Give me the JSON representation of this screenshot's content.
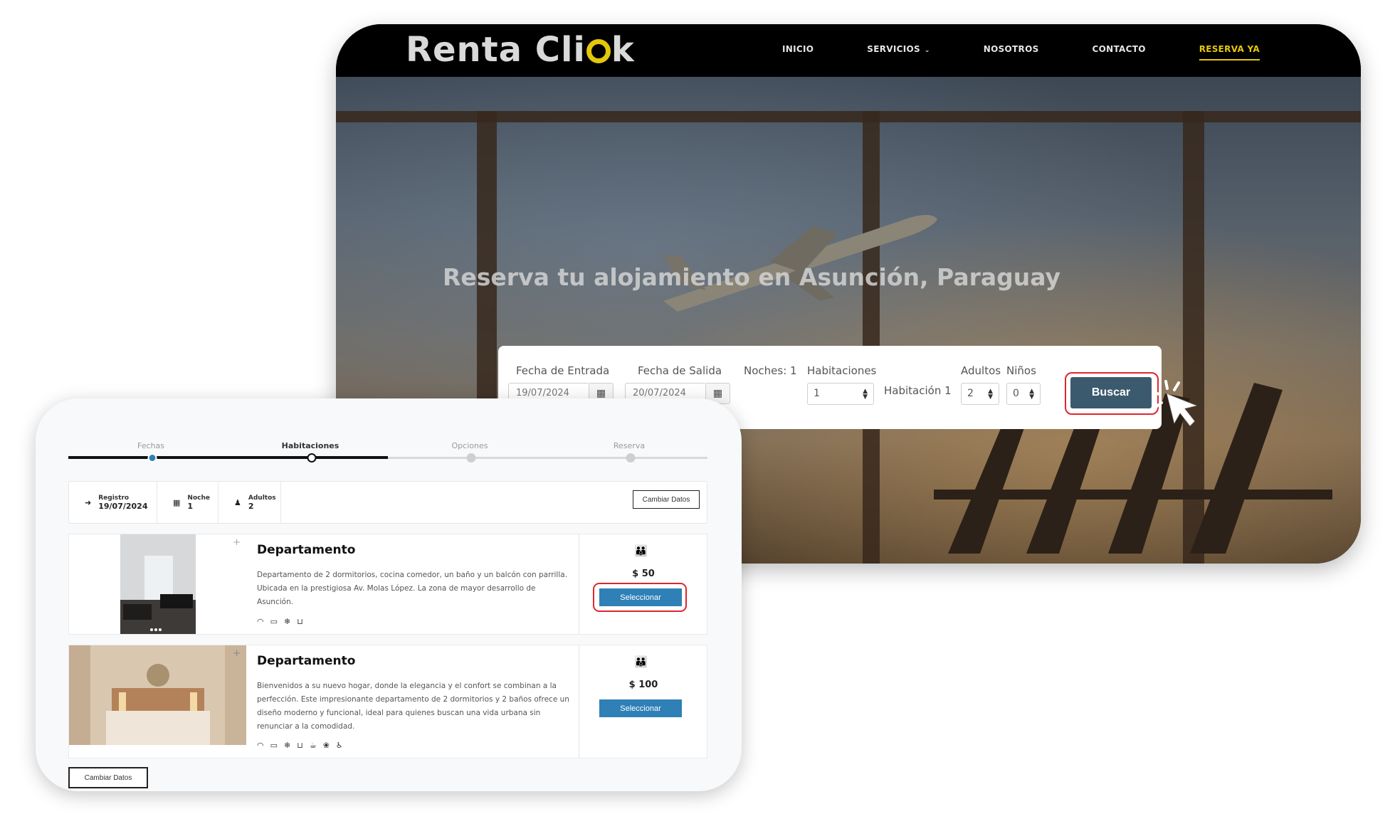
{
  "site": {
    "logo_text_a": "Renta Cli",
    "logo_text_b": "k",
    "nav": [
      {
        "label": "INICIO"
      },
      {
        "label": "SERVICIOS"
      },
      {
        "label": "NOSOTROS"
      },
      {
        "label": "CONTACTO"
      },
      {
        "label": "RESERVA YA"
      }
    ],
    "hero_title": "Reserva tu alojamiento en Asunción, Paraguay",
    "search": {
      "check_in_label": "Fecha de Entrada",
      "check_in_value": "19/07/2024",
      "check_out_label": "Fecha de Salida",
      "check_out_value": "20/07/2024",
      "nights_label": "Noches: 1",
      "rooms_label": "Habitaciones",
      "rooms_value": "1",
      "room_name": "Habitación 1",
      "adults_label": "Adultos",
      "adults_value": "2",
      "children_label": "Niños",
      "children_value": "0",
      "search_button": "Buscar"
    },
    "colors": {
      "accent": "#e3c70b",
      "button": "#3c5a6e",
      "highlight": "#e0262d"
    }
  },
  "booking": {
    "steps": [
      {
        "label": "Fechas"
      },
      {
        "label": "Habitaciones"
      },
      {
        "label": "Opciones"
      },
      {
        "label": "Reserva"
      }
    ],
    "summary": {
      "checkin_label": "Registro",
      "checkin_value": "19/07/2024",
      "night_label": "Noche",
      "night_value": "1",
      "adults_label": "Adultos",
      "adults_value": "2",
      "change_button": "Cambiar Datos"
    },
    "rooms": [
      {
        "name": "Departamento",
        "description": "Departamento de 2 dormitorios, cocina comedor, un baño y un balcón con parrilla. Ubicada en la prestigiosa Av. Molas López. La zona de mayor desarrollo de Asunción.",
        "price": "$ 50",
        "select_button": "Seleccionar",
        "amenities": [
          "wifi-icon",
          "tv-icon",
          "ac-icon",
          "bath-icon"
        ]
      },
      {
        "name": "Departamento",
        "description": "Bienvenidos a su nuevo hogar, donde la elegancia y el confort se combinan a la perfección. Este impresionante departamento de 2 dormitorios y 2 baños ofrece un diseño moderno y funcional, ideal para quienes buscan una vida urbana sin renunciar a la comodidad.",
        "price": "$ 100",
        "select_button": "Seleccionar",
        "amenities": [
          "wifi-icon",
          "tv-icon",
          "ac-icon",
          "bath-icon",
          "coffee-icon",
          "pet-icon",
          "accessible-icon"
        ]
      }
    ],
    "bottom_button": "Cambiar Datos",
    "colors": {
      "select": "#2f80b6",
      "progress_done": "#2f80b6"
    }
  }
}
